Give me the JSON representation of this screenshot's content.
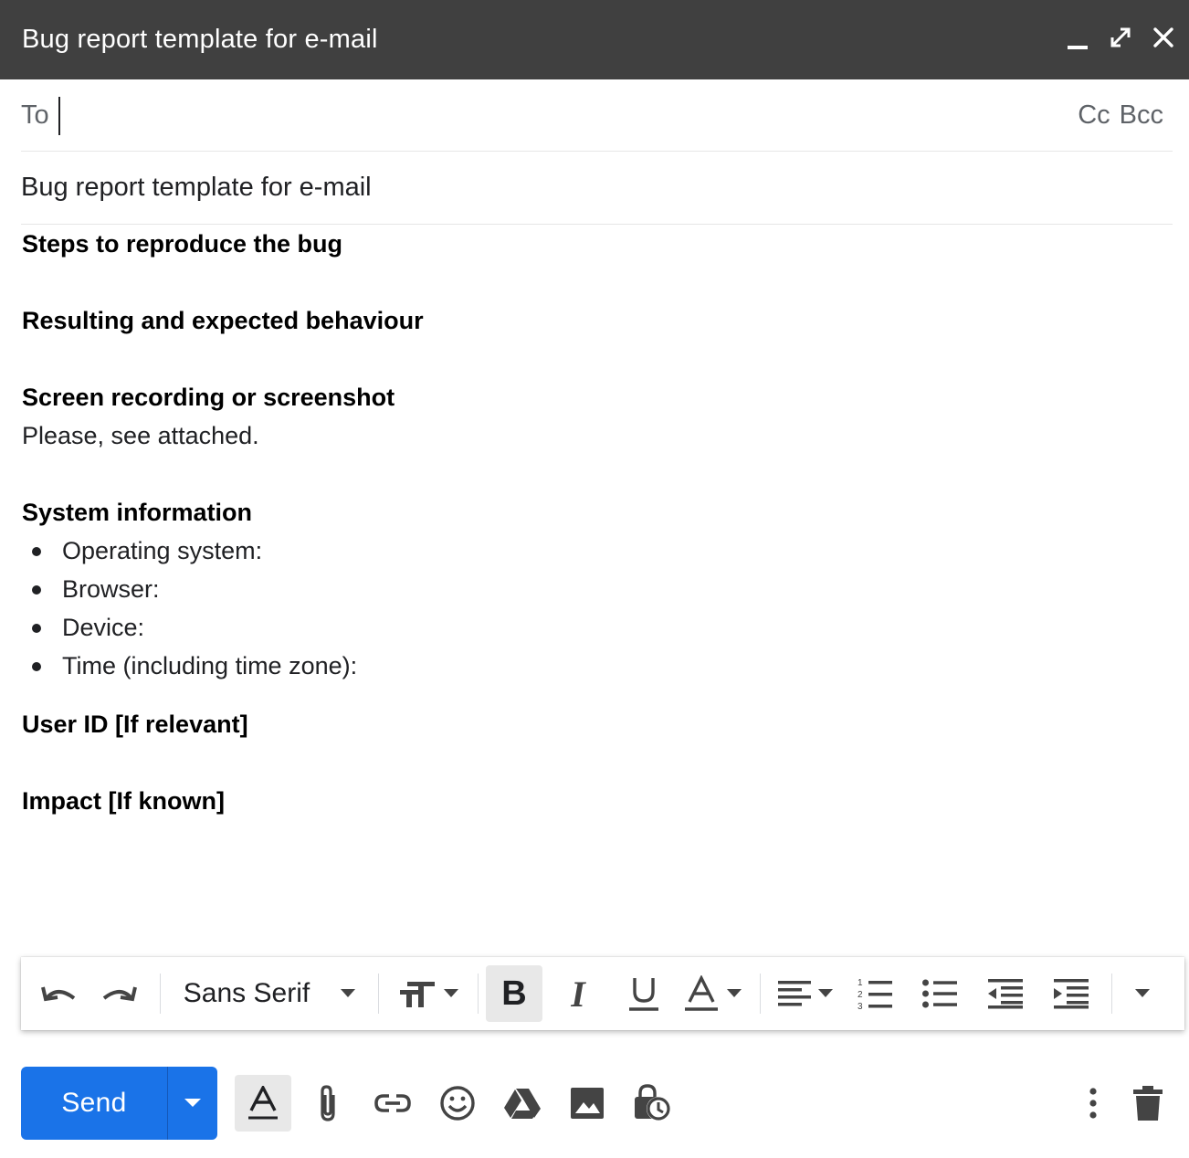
{
  "window": {
    "title": "Bug report template for e-mail",
    "controls": [
      "minimize-icon",
      "expand-icon",
      "close-icon"
    ]
  },
  "recipients": {
    "to_label": "To",
    "to_value": "",
    "cc_label": "Cc",
    "bcc_label": "Bcc"
  },
  "subject": {
    "value": "Bug report template for e-mail"
  },
  "body": {
    "steps_heading": "Steps to reproduce the bug",
    "result_heading": "Resulting and expected behaviour",
    "recording_heading": "Screen recording or screenshot",
    "recording_text": "Please, see attached.",
    "system_heading": "System information",
    "system_items": [
      "Operating system:",
      "Browser:",
      "Device:",
      "Time (including time zone):"
    ],
    "userid_heading": "User ID [If relevant]",
    "impact_heading": "Impact [If known]"
  },
  "toolbar": {
    "font_name": "Sans Serif",
    "bold_active": true,
    "icons": [
      "undo-icon",
      "redo-icon",
      "font-size-icon",
      "bold-icon",
      "italic-icon",
      "underline-icon",
      "text-color-icon",
      "align-icon",
      "numbered-list-icon",
      "bulleted-list-icon",
      "indent-less-icon",
      "indent-more-icon",
      "more-formatting-icon"
    ]
  },
  "actions": {
    "send_label": "Send",
    "icons": [
      "formatting-options-icon",
      "attach-icon",
      "link-icon",
      "emoji-icon",
      "drive-icon",
      "photo-icon",
      "confidential-mode-icon",
      "more-options-icon",
      "discard-icon"
    ]
  },
  "colors": {
    "titlebar": "#404040",
    "send": "#1a73e8",
    "text": "#202124",
    "muted": "#5f6368"
  }
}
